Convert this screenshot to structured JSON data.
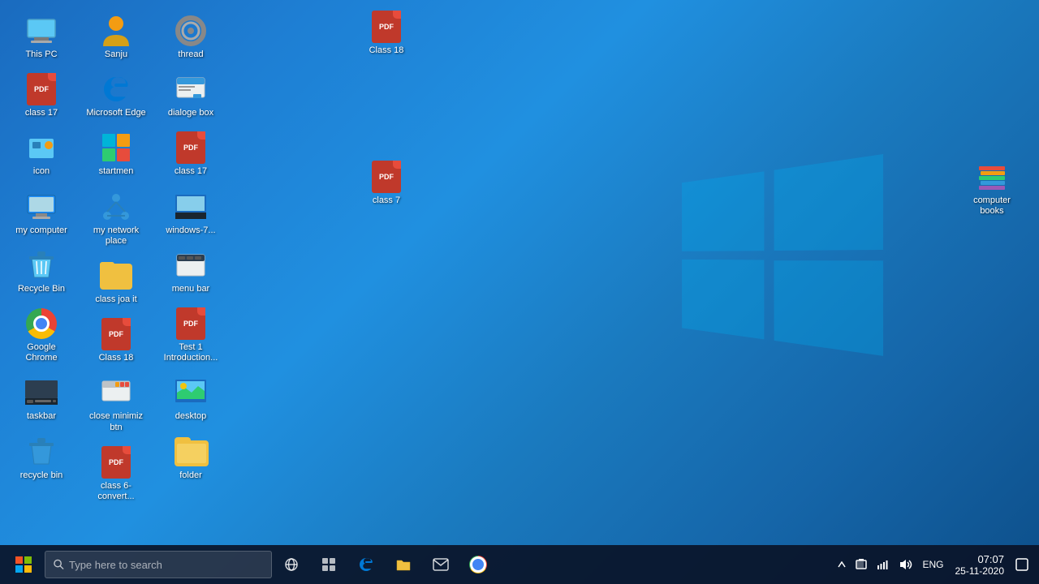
{
  "desktop": {
    "icons": [
      {
        "id": "this-pc",
        "label": "This PC",
        "type": "computer",
        "col": 0,
        "row": 0
      },
      {
        "id": "class17-1",
        "label": "class 17",
        "type": "msoffice",
        "col": 0,
        "row": 1
      },
      {
        "id": "icon",
        "label": "icon",
        "type": "folder-img",
        "col": 0,
        "row": 2
      },
      {
        "id": "my-computer",
        "label": "my computer",
        "type": "mycomputer",
        "col": 0,
        "row": 3
      },
      {
        "id": "recycle-bin",
        "label": "Recycle Bin",
        "type": "recycle",
        "col": 1,
        "row": 0
      },
      {
        "id": "google-chrome",
        "label": "Google Chrome",
        "type": "chrome",
        "col": 1,
        "row": 1
      },
      {
        "id": "taskbar",
        "label": "taskbar",
        "type": "taskbar-img",
        "col": 1,
        "row": 2
      },
      {
        "id": "recycle-bin2",
        "label": "recycle bin",
        "type": "recycle2",
        "col": 1,
        "row": 3
      },
      {
        "id": "sanju",
        "label": "Sanju",
        "type": "img",
        "col": 2,
        "row": 0
      },
      {
        "id": "ms-edge",
        "label": "Microsoft Edge",
        "type": "edge",
        "col": 2,
        "row": 1
      },
      {
        "id": "startmen",
        "label": "startmen",
        "type": "startmen-img",
        "col": 2,
        "row": 2
      },
      {
        "id": "my-network",
        "label": "my network place",
        "type": "network",
        "col": 2,
        "row": 3
      },
      {
        "id": "class-joa-it",
        "label": "class joa it",
        "type": "folder2",
        "col": 3,
        "row": 0
      },
      {
        "id": "class18-2",
        "label": "Class 18",
        "type": "msoffice2",
        "col": 3,
        "row": 1
      },
      {
        "id": "close-min",
        "label": "close minimiz btn",
        "type": "close-img",
        "col": 3,
        "row": 2
      },
      {
        "id": "class6",
        "label": "class 6-convert...",
        "type": "pdf",
        "col": 4,
        "row": 0
      },
      {
        "id": "thread",
        "label": "thread",
        "type": "thread-img",
        "col": 4,
        "row": 1
      },
      {
        "id": "dialoge-box",
        "label": "dialoge box",
        "type": "dialoge-img",
        "col": 4,
        "row": 2
      },
      {
        "id": "class17-2",
        "label": "class 17",
        "type": "pdf2",
        "col": 5,
        "row": 0
      },
      {
        "id": "windows7",
        "label": "windows-7...",
        "type": "win7-img",
        "col": 5,
        "row": 1
      },
      {
        "id": "menu-bar",
        "label": "menu bar",
        "type": "menubar-img",
        "col": 5,
        "row": 2
      },
      {
        "id": "test1",
        "label": "Test 1 Introduction...",
        "type": "pdf3",
        "col": 6,
        "row": 0
      },
      {
        "id": "desktop-img",
        "label": "desktop",
        "type": "desktop-img",
        "col": 6,
        "row": 1
      },
      {
        "id": "folder",
        "label": "folder",
        "type": "folder",
        "col": 6,
        "row": 2
      }
    ],
    "class18_top": {
      "label": "Class 18",
      "type": "pdf_top"
    },
    "class7": {
      "label": "class 7",
      "type": "pdf_class7"
    },
    "computer_books": {
      "label": "computer books",
      "type": "books"
    }
  },
  "taskbar": {
    "search_placeholder": "Type here to search",
    "clock_time": "07:07",
    "clock_date": "25-11-2020",
    "language": "ENG"
  }
}
